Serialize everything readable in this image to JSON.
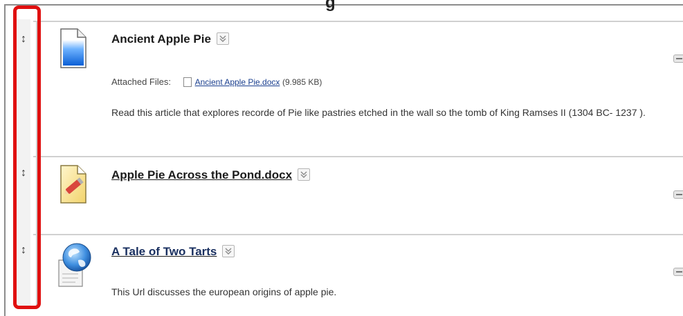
{
  "page": {
    "heading_fragment": "g"
  },
  "items": [
    {
      "title": "Ancient Apple Pie",
      "attached_label": "Attached Files:",
      "file_name": "Ancient Apple Pie.docx",
      "file_size": "(9.985 KB)",
      "description": "Read this article that explores recorde of Pie like pastries etched in the wall so the tomb of King Ramses II (1304 BC- 1237 )."
    },
    {
      "title": "Apple Pie Across the Pond.docx"
    },
    {
      "title": "A Tale of Two Tarts",
      "description": "This Url discusses the european origins of apple pie."
    }
  ],
  "icons": {
    "drag_handle": "↕"
  },
  "colors": {
    "highlight": "#e01010",
    "link": "#1a3f8f"
  }
}
